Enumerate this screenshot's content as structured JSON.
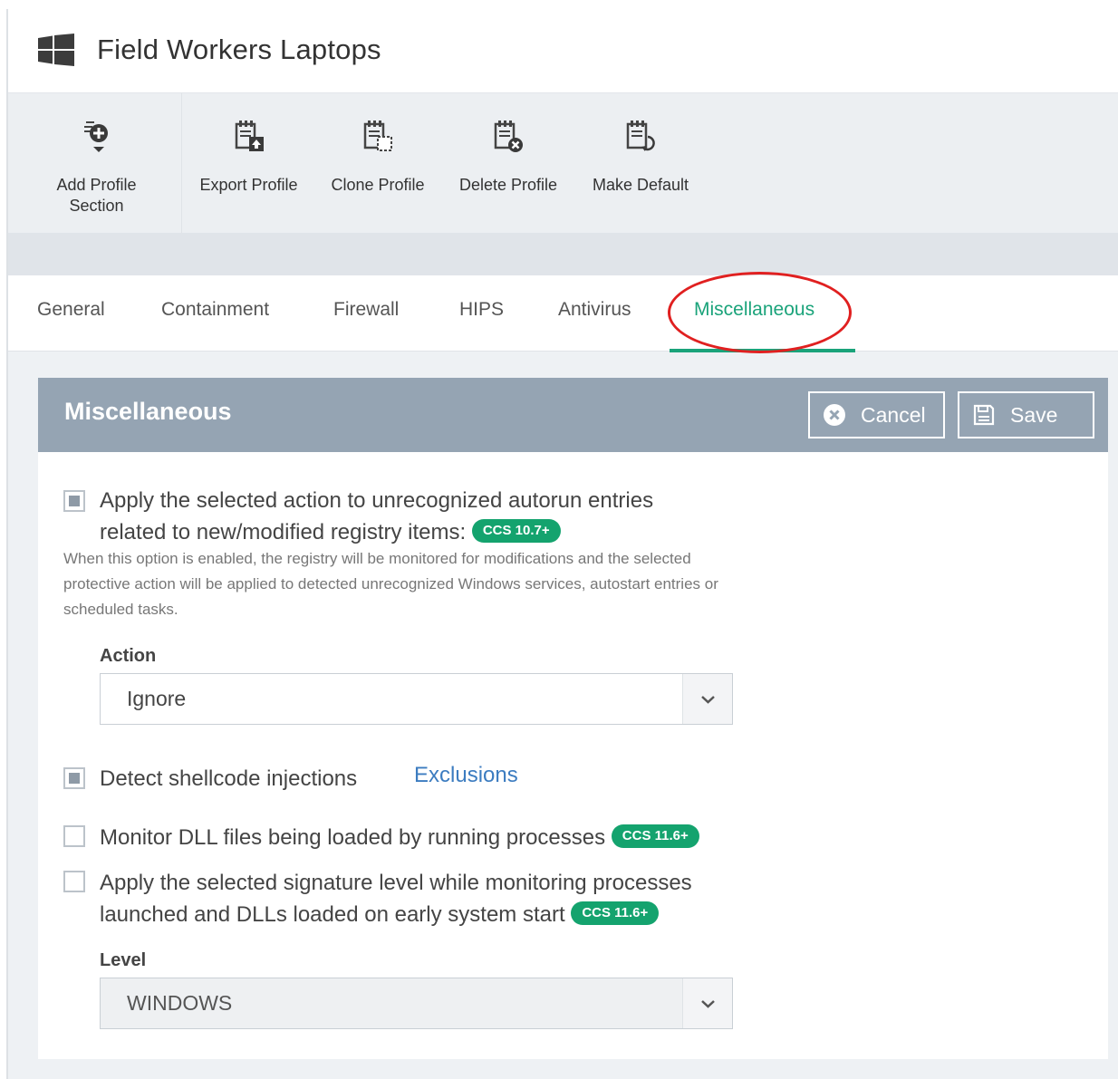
{
  "header": {
    "title": "Field Workers Laptops",
    "icon": "windows-logo-icon"
  },
  "toolbar": [
    {
      "label": "Add Profile\nSection",
      "icon": "add-profile-section-icon"
    },
    {
      "label": "Export Profile",
      "icon": "export-profile-icon"
    },
    {
      "label": "Clone Profile",
      "icon": "clone-profile-icon"
    },
    {
      "label": "Delete Profile",
      "icon": "delete-profile-icon"
    },
    {
      "label": "Make Default",
      "icon": "make-default-icon"
    }
  ],
  "tabs": [
    {
      "label": "General"
    },
    {
      "label": "Containment"
    },
    {
      "label": "Firewall"
    },
    {
      "label": "HIPS"
    },
    {
      "label": "Antivirus"
    },
    {
      "label": "Miscellaneous",
      "active": true
    }
  ],
  "panel": {
    "title": "Miscellaneous",
    "cancel_label": "Cancel",
    "save_label": "Save",
    "options": [
      {
        "text_line1": "Apply the selected action to unrecognized autorun entries",
        "text_line2": "related to new/modified registry items:",
        "badge": "CCS 10.7+",
        "checked": true
      },
      {
        "text": "Detect shellcode injections",
        "checked": true
      },
      {
        "text": "Monitor DLL files being loaded by running processes",
        "badge": "CCS 11.6+",
        "checked": false
      },
      {
        "text_line1": "Apply the selected signature level while monitoring processes",
        "text_line2": "launched and DLLs loaded on early system start",
        "badge": "CCS 11.6+",
        "checked": false
      }
    ],
    "description": "When this option is enabled, the registry will be monitored for modifications and the selected protective action will be applied to detected unrecognized Windows services, autostart entries or scheduled tasks.",
    "action_label": "Action",
    "action_value": "Ignore",
    "exclusions_link": "Exclusions",
    "level_label": "Level",
    "level_value": "WINDOWS"
  },
  "colors": {
    "accent": "#1aa37a",
    "badge": "#14a36e",
    "panel_header": "#95a4b3",
    "link": "#3c7cc0",
    "annotation_circle": "#e02020"
  }
}
